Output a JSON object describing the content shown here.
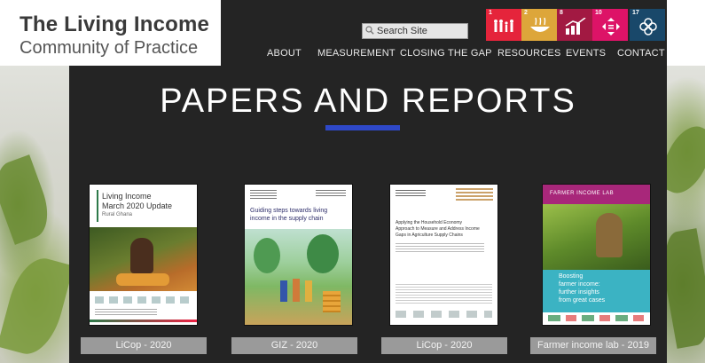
{
  "header": {
    "logo_line1": "The Living Income",
    "logo_line2": "Community of Practice",
    "search_placeholder": "Search Site"
  },
  "sdg_tiles": [
    {
      "number": "1",
      "label": "POVERTY",
      "color": "#e5243b",
      "icon": "family-icon"
    },
    {
      "number": "2",
      "label": "HUNGER",
      "color": "#dda63a",
      "icon": "bowl-icon"
    },
    {
      "number": "8",
      "label": "DECENT WORK",
      "color": "#a21942",
      "icon": "growth-chart-icon"
    },
    {
      "number": "10",
      "label": "INEQUALITIES",
      "color": "#dd1367",
      "icon": "equality-arrows-icon"
    },
    {
      "number": "17",
      "label": "FOR THE GOALS",
      "color": "#19486a",
      "icon": "partnership-flower-icon"
    }
  ],
  "nav": [
    "ABOUT",
    "MEASUREMENT",
    "CLOSING THE GAP",
    "RESOURCES",
    "EVENTS",
    "CONTACT"
  ],
  "page_title": "PAPERS AND REPORTS",
  "colors": {
    "accent_bar": "#2e48c8",
    "panel": "#242424",
    "caption_bg": "#9a9a9a"
  },
  "reports": [
    {
      "caption": "LiCop - 2020",
      "cover_title_1": "Living Income",
      "cover_title_2": "March 2020 Update",
      "cover_subtitle": "Rural Ghana"
    },
    {
      "caption": "GIZ - 2020",
      "cover_title_1": "Guiding steps towards living",
      "cover_title_2": "income in the supply chain"
    },
    {
      "caption": "LiCop - 2020",
      "cover_title_1": "Applying the Household Economy",
      "cover_title_2": "Approach to Measure and Address Income",
      "cover_title_3": "Gaps in Agriculture Supply Chains"
    },
    {
      "caption": "Farmer income lab - 2019",
      "cover_header": "FARMER INCOME LAB",
      "cover_title_1": "Boosting",
      "cover_title_2": "farmer income:",
      "cover_title_3": "further insights",
      "cover_title_4": "from great cases"
    }
  ]
}
